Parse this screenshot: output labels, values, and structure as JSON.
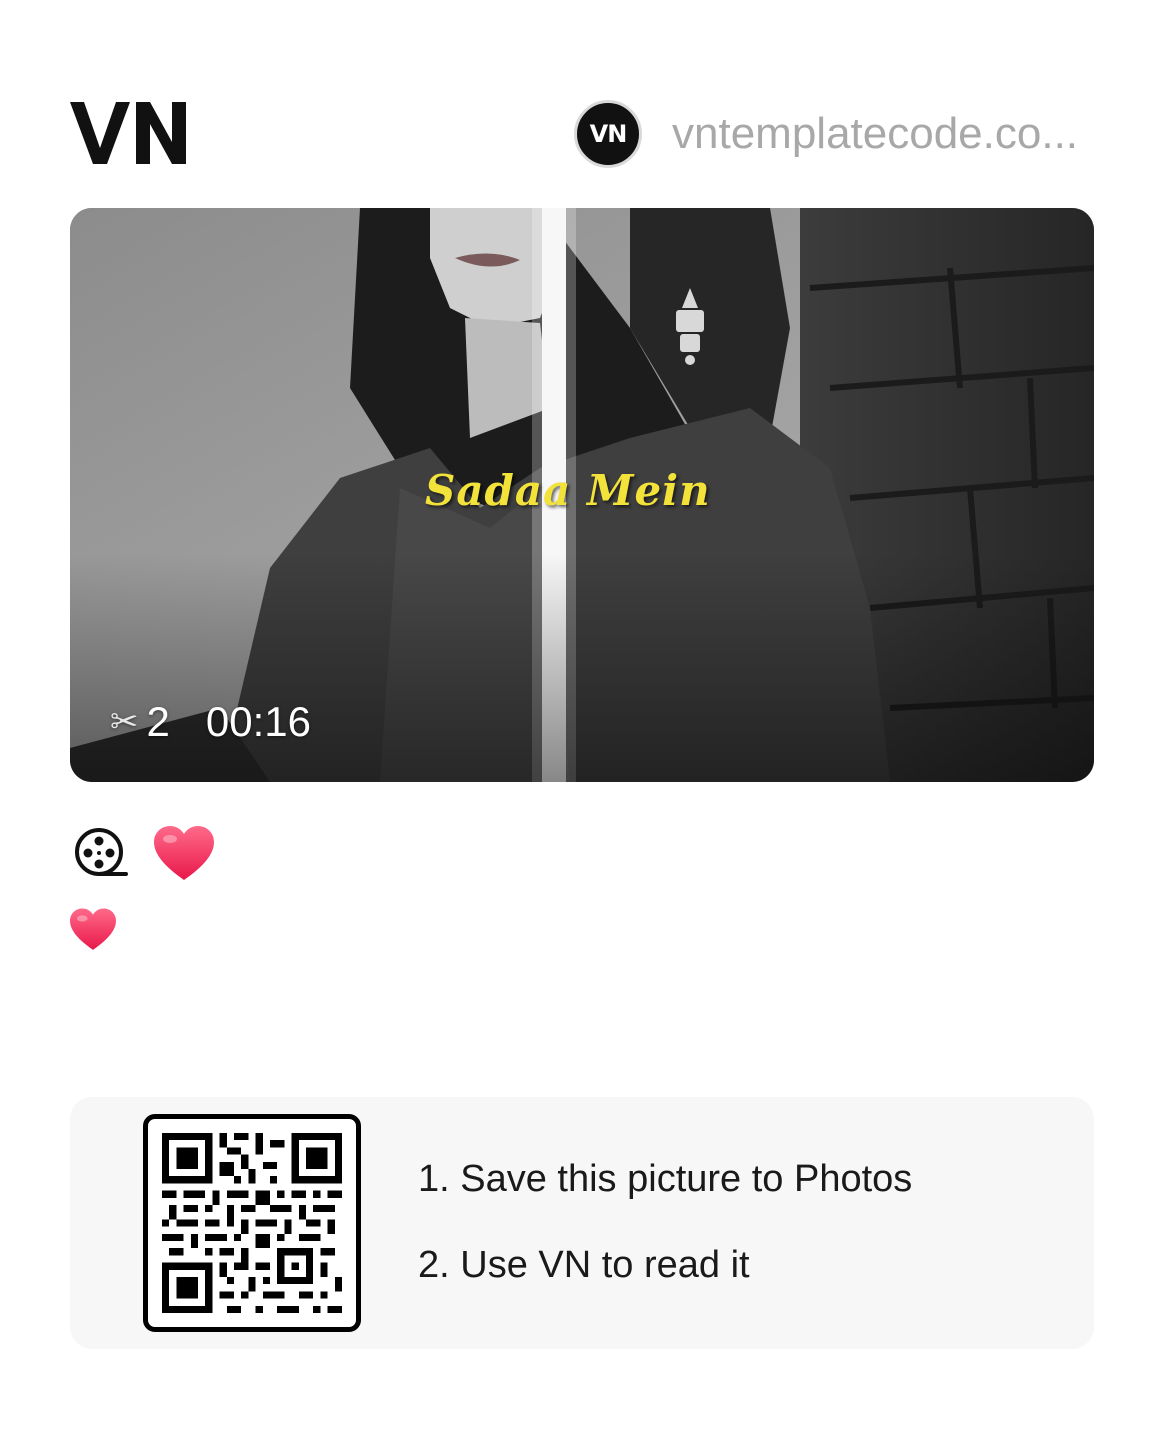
{
  "header": {
    "logo_text": "VN",
    "author_avatar_text": "VN",
    "author_name": "vntemplatecode.co..."
  },
  "preview": {
    "caption": "Sadaa Mein",
    "clips_icon": "scissors-icon",
    "clips_count": "2",
    "duration": "00:16"
  },
  "actions": {
    "icons": [
      "film-reel-icon",
      "heart-icon",
      "heart-icon"
    ]
  },
  "qr": {
    "step1": "1. Save this picture to Photos",
    "step2": "2. Use VN to read it"
  },
  "colors": {
    "caption": "#f2e23a",
    "heart": "#f0305c",
    "panel": "#f7f7f7",
    "author_name": "#a8a8a8"
  }
}
